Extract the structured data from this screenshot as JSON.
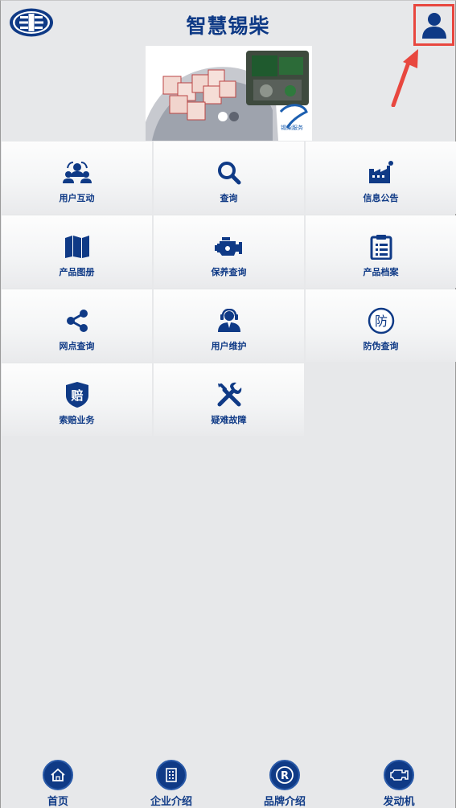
{
  "header": {
    "title": "智慧锡柴",
    "logo_icon": "faw-logo-icon",
    "profile_icon": "user-icon"
  },
  "colors": {
    "brand_blue": "#0f3a86",
    "highlight_red": "#e8473f",
    "background": "#e7e8ea"
  },
  "banner": {
    "image": "engine-and-staff-photo-banner"
  },
  "menu": [
    {
      "label": "用户互动",
      "icon": "user-group-icon"
    },
    {
      "label": "查询",
      "icon": "search-icon"
    },
    {
      "label": "信息公告",
      "icon": "factory-icon"
    },
    {
      "label": "产品图册",
      "icon": "map-book-icon"
    },
    {
      "label": "保养查询",
      "icon": "engine-icon"
    },
    {
      "label": "产品档案",
      "icon": "clipboard-icon"
    },
    {
      "label": "网点查询",
      "icon": "share-icon"
    },
    {
      "label": "用户维护",
      "icon": "support-agent-icon"
    },
    {
      "label": "防伪查询",
      "icon": "anti-fake-icon",
      "icon_text": "防"
    },
    {
      "label": "索赔业务",
      "icon": "claim-shield-icon",
      "icon_text": "赔"
    },
    {
      "label": "疑难故障",
      "icon": "tools-icon"
    }
  ],
  "bottom_nav": [
    {
      "label": "首页",
      "icon": "home-icon"
    },
    {
      "label": "企业介绍",
      "icon": "building-icon"
    },
    {
      "label": "品牌介绍",
      "icon": "registered-icon",
      "icon_text": "R"
    },
    {
      "label": "发动机",
      "icon": "engine-icon"
    }
  ]
}
